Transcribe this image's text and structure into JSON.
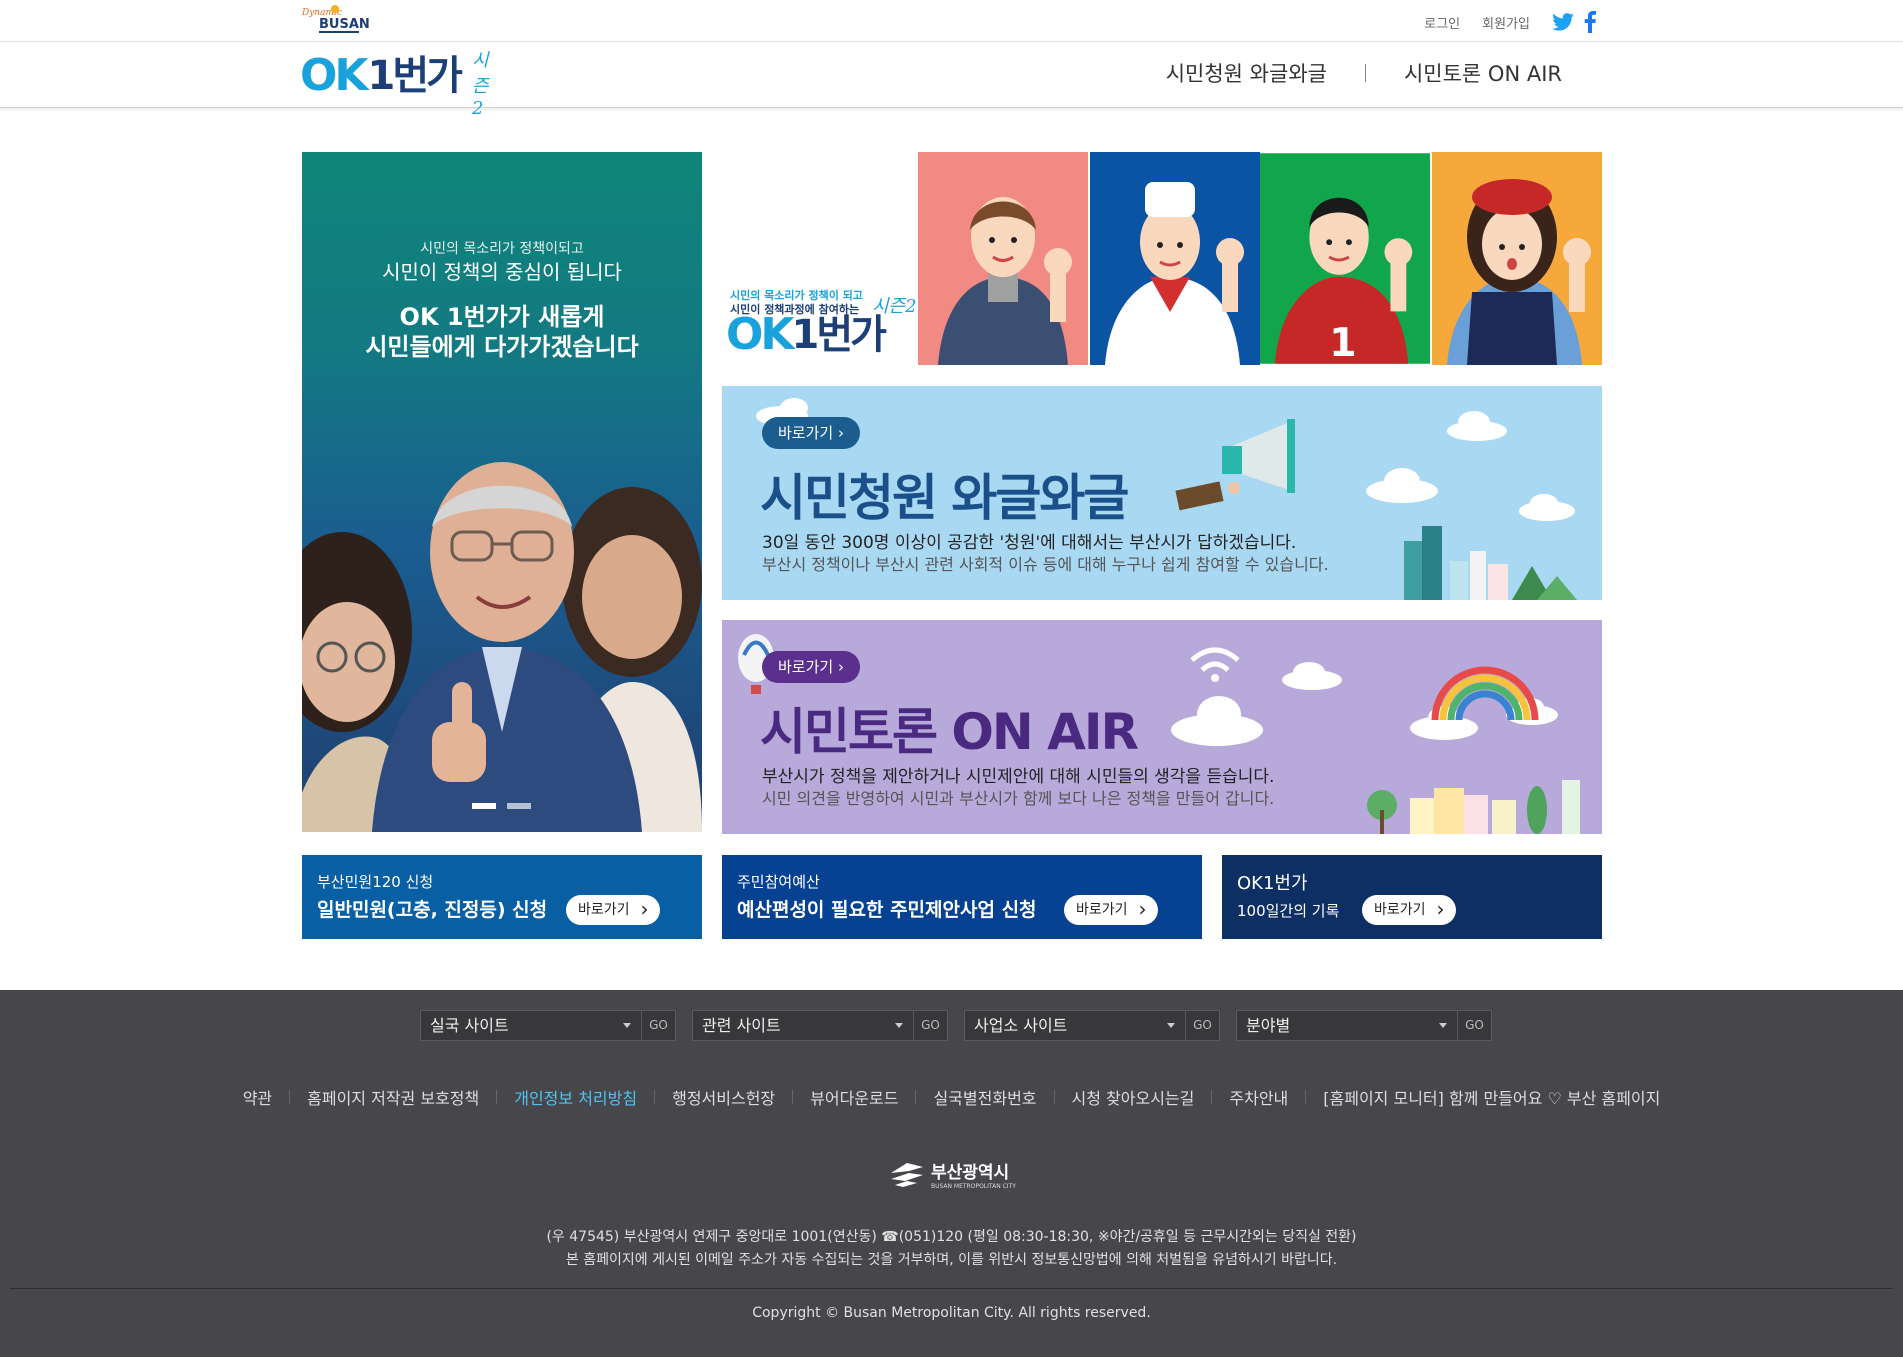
{
  "topbar": {
    "logo_top": "Dynamic",
    "logo_main": "BUSAN",
    "login": "로그인",
    "join": "회원가입",
    "icons": [
      "twitter-icon",
      "facebook-icon"
    ]
  },
  "header": {
    "brand_ok": "OK",
    "brand_num": "1번가",
    "brand_season": "시즌2",
    "nav": [
      "시민청원 와글와글",
      "시민토론 ON AIR"
    ]
  },
  "hero": {
    "sub": "시민의 목소리가 정책이되고",
    "sub2": "시민이 정책의 중심이 됩니다",
    "main_line1": "OK 1번가가 새롭게",
    "main_line2": "시민들에게 다가가겠습니다",
    "slide_count": 2,
    "active_slide": 1
  },
  "banner_top": {
    "small_1": "시민의 목소리가 정책이 되고",
    "small_2a": "시민이 정책과정에 참여하는",
    "season": "시즌2",
    "logo_ok": "OK",
    "logo_num": "1번가",
    "panel_colors": [
      "#f28a84",
      "#0a54a3",
      "#11a64c",
      "#f7a83b"
    ]
  },
  "petition": {
    "pill": "바로가기",
    "title": "시민청원 와글와글",
    "desc1": "30일 동안 300명 이상이 공감한 '청원'에 대해서는 부산시가 답하겠습니다.",
    "desc2": "부산시 정책이나 부산시 관련 사회적 이슈 등에 대해 누구나 쉽게 참여할 수 있습니다."
  },
  "onair": {
    "pill": "바로가기",
    "title": "시민토론 ON AIR",
    "desc1": "부산시가 정책을 제안하거나 시민제안에 대해 시민들의 생각을 듣습니다.",
    "desc2": "시민 의견을 반영하여 시민과 부산시가 함께 보다 나은 정책을 만들어 갑니다."
  },
  "boxes": [
    {
      "small": "부산민원120 신청",
      "big": "일반민원(고충, 진정등) 신청",
      "button": "바로가기"
    },
    {
      "small": "주민참여예산",
      "big": "예산편성이 필요한 주민제안사업 신청",
      "button": "바로가기"
    },
    {
      "small": "OK1번가",
      "big": "100일간의 기록",
      "button": "바로가기"
    }
  ],
  "footer": {
    "selects": [
      {
        "label": "실국 사이트",
        "go": "GO"
      },
      {
        "label": "관련 사이트",
        "go": "GO"
      },
      {
        "label": "사업소 사이트",
        "go": "GO"
      },
      {
        "label": "분야별",
        "go": "GO"
      }
    ],
    "links": [
      "약관",
      "홈페이지 저작권 보호정책",
      "개인정보 처리방침",
      "행정서비스헌장",
      "뷰어다운로드",
      "실국별전화번호",
      "시청 찾아오시는길",
      "주차안내",
      "[홈페이지 모니터] 함께 만들어요 ♡ 부산 홈페이지"
    ],
    "highlight_link": "개인정보 처리방침",
    "logo_ko": "부산광역시",
    "logo_en": "BUSAN METROPOLITAN CITY",
    "address": "(우 47545) 부산광역시 연제구 중앙대로 1001(연산동) ☎(051)120 (평일 08:30-18:30, ※야간/공휴일 등 근무시간외는 당직실 전환)",
    "notice": "본 홈페이지에 게시된 이메일 주소가 자동 수집되는 것을 거부하며, 이를 위반시 정보통신망법에 의해 처벌됨을 유념하시기 바랍니다.",
    "copyright": "Copyright © Busan Metropolitan City. All rights reserved."
  },
  "colors": {
    "brand_blue": "#1aa2dc",
    "brand_navy": "#1c3f78",
    "footer_bg": "#47474b",
    "link_highlight": "#4fc4f0"
  }
}
